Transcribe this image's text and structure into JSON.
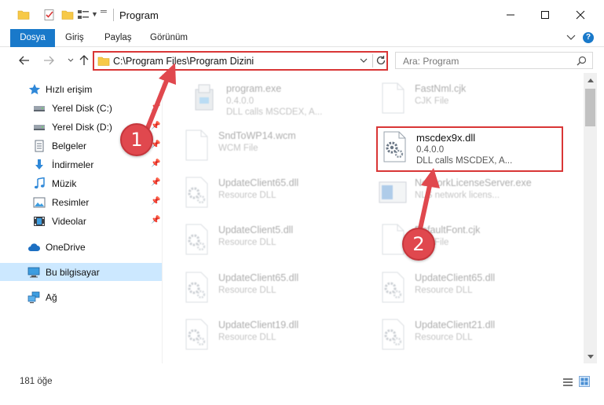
{
  "window": {
    "title": "Program",
    "minimize_glyph": "—",
    "close_glyph": "✕"
  },
  "ribbon": {
    "tabs": [
      {
        "label": "Dosya",
        "active": true
      },
      {
        "label": "Giriş"
      },
      {
        "label": "Paylaş"
      },
      {
        "label": "Görünüm"
      }
    ],
    "help_label": "?"
  },
  "address": {
    "path": "C:\\Program Files\\Program Dizini",
    "search_placeholder": "Ara: Program"
  },
  "sidebar": {
    "items": [
      {
        "label": "Hızlı erişim",
        "icon": "star-icon",
        "pinned": false
      },
      {
        "label": "Yerel Disk (C:)",
        "icon": "drive-icon",
        "pinned": true
      },
      {
        "label": "Yerel Disk (D:)",
        "icon": "drive-icon",
        "pinned": true
      },
      {
        "label": "Belgeler",
        "icon": "documents-icon",
        "pinned": true
      },
      {
        "label": "İndirmeler",
        "icon": "download-icon",
        "pinned": true
      },
      {
        "label": "Müzik",
        "icon": "music-icon",
        "pinned": true
      },
      {
        "label": "Resimler",
        "icon": "pictures-icon",
        "pinned": true
      },
      {
        "label": "Videolar",
        "icon": "videos-icon",
        "pinned": true
      },
      {
        "label": "OneDrive",
        "icon": "cloud-icon"
      },
      {
        "label": "Bu bilgisayar",
        "icon": "computer-icon",
        "selected": true
      },
      {
        "label": "Ağ",
        "icon": "network-icon"
      }
    ]
  },
  "files": [
    {
      "name": "program.exe",
      "line1": "0.4.0.0",
      "line2": "DLL calls MSCDEX, A...",
      "icon": "installer-icon"
    },
    {
      "name": "FastNml.cjk",
      "line1": "CJK File",
      "line2": "",
      "icon": "blank-file-icon"
    },
    {
      "name": "SndToWP14.wcm",
      "line1": "WCM File",
      "line2": "",
      "icon": "blank-file-icon"
    },
    {
      "name": "mscdex9x.dll",
      "line1": "0.4.0.0",
      "line2": "DLL calls MSCDEX, A...",
      "icon": "dll-gear-icon"
    },
    {
      "name": "UpdateClient65.dll",
      "line1": "Resource DLL",
      "line2": "",
      "icon": "dll-gear-icon"
    },
    {
      "name": "NetworkLicenseServer.exe",
      "line1": "NLS network licens...",
      "line2": "",
      "icon": "app-window-icon"
    },
    {
      "name": "UpdateClient5.dll",
      "line1": "Resource DLL",
      "line2": "",
      "icon": "dll-gear-icon"
    },
    {
      "name": "DefaultFont.cjk",
      "line1": "CJK File",
      "line2": "",
      "icon": "blank-file-icon"
    },
    {
      "name": "UpdateClient65.dll",
      "line1": "Resource DLL",
      "line2": "",
      "icon": "dll-gear-icon"
    },
    {
      "name": "UpdateClient65.dll",
      "line1": "Resource DLL",
      "line2": "",
      "icon": "dll-gear-icon"
    },
    {
      "name": "UpdateClient19.dll",
      "line1": "Resource DLL",
      "line2": "",
      "icon": "dll-gear-icon"
    },
    {
      "name": "UpdateClient21.dll",
      "line1": "Resource DLL",
      "line2": "",
      "icon": "dll-gear-icon"
    }
  ],
  "status": {
    "item_count": "181 öğe"
  },
  "annotations": {
    "step1": "1",
    "step2": "2",
    "color": "#d93636"
  }
}
